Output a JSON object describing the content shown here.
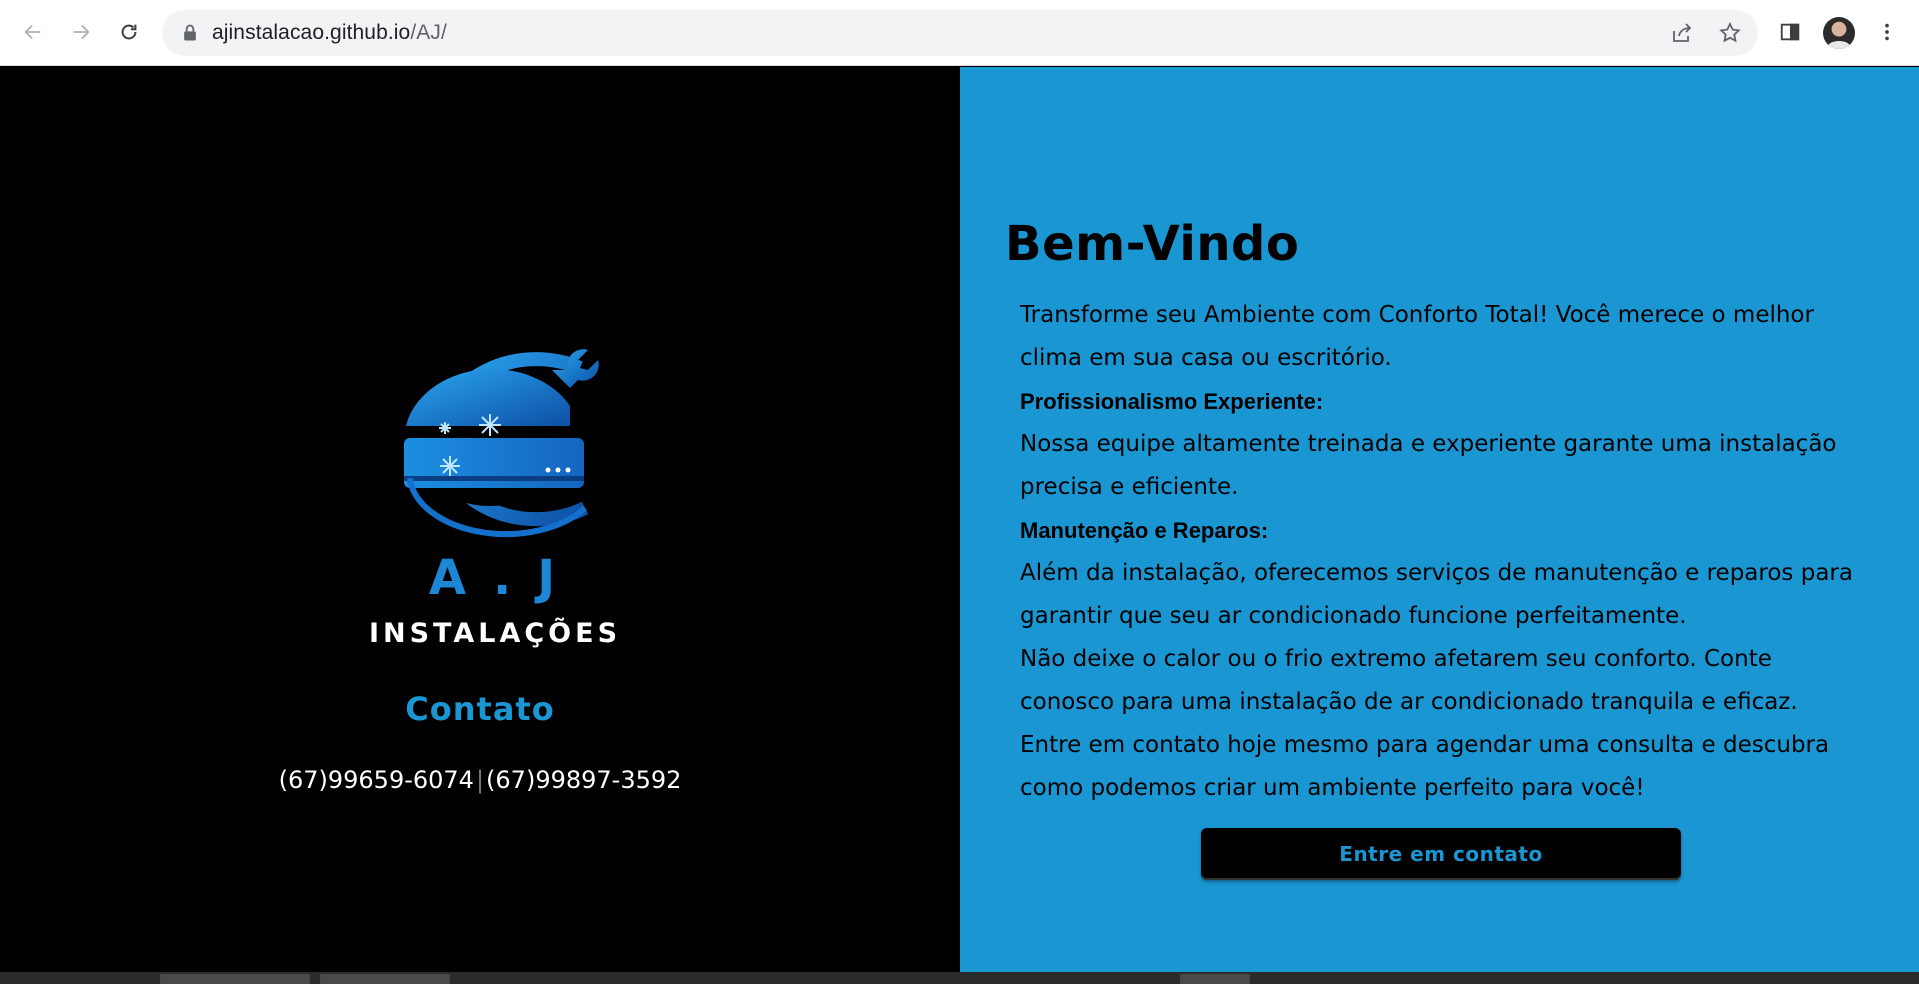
{
  "browser": {
    "url_host": "ajinstalacao.github.io",
    "url_path": "/AJ/",
    "icons": [
      "back-arrow-icon",
      "forward-arrow-icon",
      "reload-icon",
      "lock-icon",
      "share-icon",
      "star-icon",
      "side-panel-icon",
      "avatar",
      "menu-kebab-icon"
    ]
  },
  "logo": {
    "brand": "A.J",
    "subtitle": "INSTALAÇÕES"
  },
  "contact": {
    "title": "Contato",
    "phone1": "(67)99659-6074",
    "separator": "|",
    "phone2": "(67)99897-3592"
  },
  "welcome": {
    "title": "Bem-Vindo",
    "intro": "Transforme seu Ambiente com Conforto Total! Você merece o melhor clima em sua casa ou escritório.",
    "heading1": "Profissionalismo Experiente:",
    "text1": "Nossa equipe altamente treinada e experiente garante uma instalação precisa e eficiente.",
    "heading2": "Manutenção e Reparos:",
    "text2": "Além da instalação, oferecemos serviços de manutenção e reparos para garantir que seu ar condicionado funcione perfeitamente.",
    "text3": "Não deixe o calor ou o frio extremo afetarem seu conforto. Conte conosco para uma instalação de ar condicionado tranquila e eficaz.",
    "text4": "Entre em contato hoje mesmo para agendar uma consulta e descubra como podemos criar um ambiente perfeito para você!",
    "cta_label": "Entre em contato"
  },
  "colors": {
    "accent_blue": "#1a96d2",
    "logo_blue": "#1d87d6",
    "background_left": "#000000",
    "cta_background": "#000000"
  }
}
